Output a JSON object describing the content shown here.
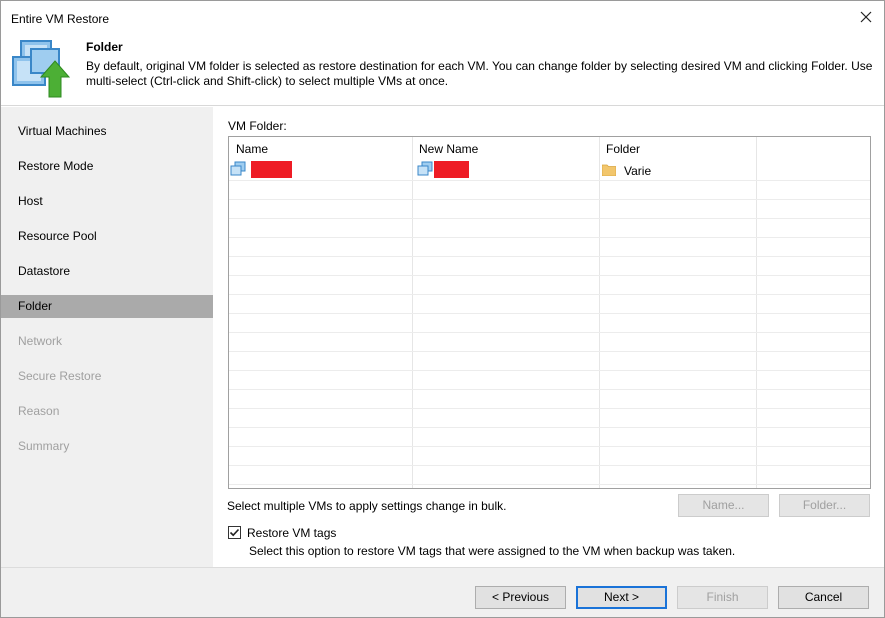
{
  "window": {
    "title": "Entire VM Restore"
  },
  "header": {
    "title": "Folder",
    "description": "By default, original VM folder is selected as restore destination for each VM. You can change folder by selecting desired VM and clicking Folder. Use multi-select (Ctrl-click and Shift-click) to select multiple VMs at once."
  },
  "sidebar": {
    "items": [
      {
        "label": "Virtual Machines",
        "state": "enabled"
      },
      {
        "label": "Restore Mode",
        "state": "enabled"
      },
      {
        "label": "Host",
        "state": "enabled"
      },
      {
        "label": "Resource Pool",
        "state": "enabled"
      },
      {
        "label": "Datastore",
        "state": "enabled"
      },
      {
        "label": "Folder",
        "state": "active"
      },
      {
        "label": "Network",
        "state": "disabled"
      },
      {
        "label": "Secure Restore",
        "state": "disabled"
      },
      {
        "label": "Reason",
        "state": "disabled"
      },
      {
        "label": "Summary",
        "state": "disabled"
      }
    ]
  },
  "main": {
    "vm_folder_label": "VM Folder:",
    "table": {
      "columns": [
        "Name",
        "New Name",
        "Folder"
      ],
      "rows": [
        {
          "name": "",
          "new_name": "",
          "folder": "Varie"
        }
      ]
    },
    "bulk_hint": "Select multiple VMs to apply settings change in bulk.",
    "name_button": "Name...",
    "folder_button": "Folder...",
    "restore_tags": {
      "label": "Restore VM tags",
      "checked": true,
      "description": "Select this option to restore VM tags that were assigned to the VM when backup was taken."
    }
  },
  "footer": {
    "previous": "< Previous",
    "next": "Next >",
    "finish": "Finish",
    "cancel": "Cancel"
  },
  "colors": {
    "active_nav": "#aaaaaa",
    "primary_border": "#1a73d8",
    "redaction": "#ee1c25",
    "folder_icon": "#f2c66c"
  },
  "icons": {
    "close": "close-icon",
    "header": "vm-restore-icon",
    "vm": "vm-icon",
    "folder": "folder-icon",
    "checkbox": "checkmark-icon"
  }
}
